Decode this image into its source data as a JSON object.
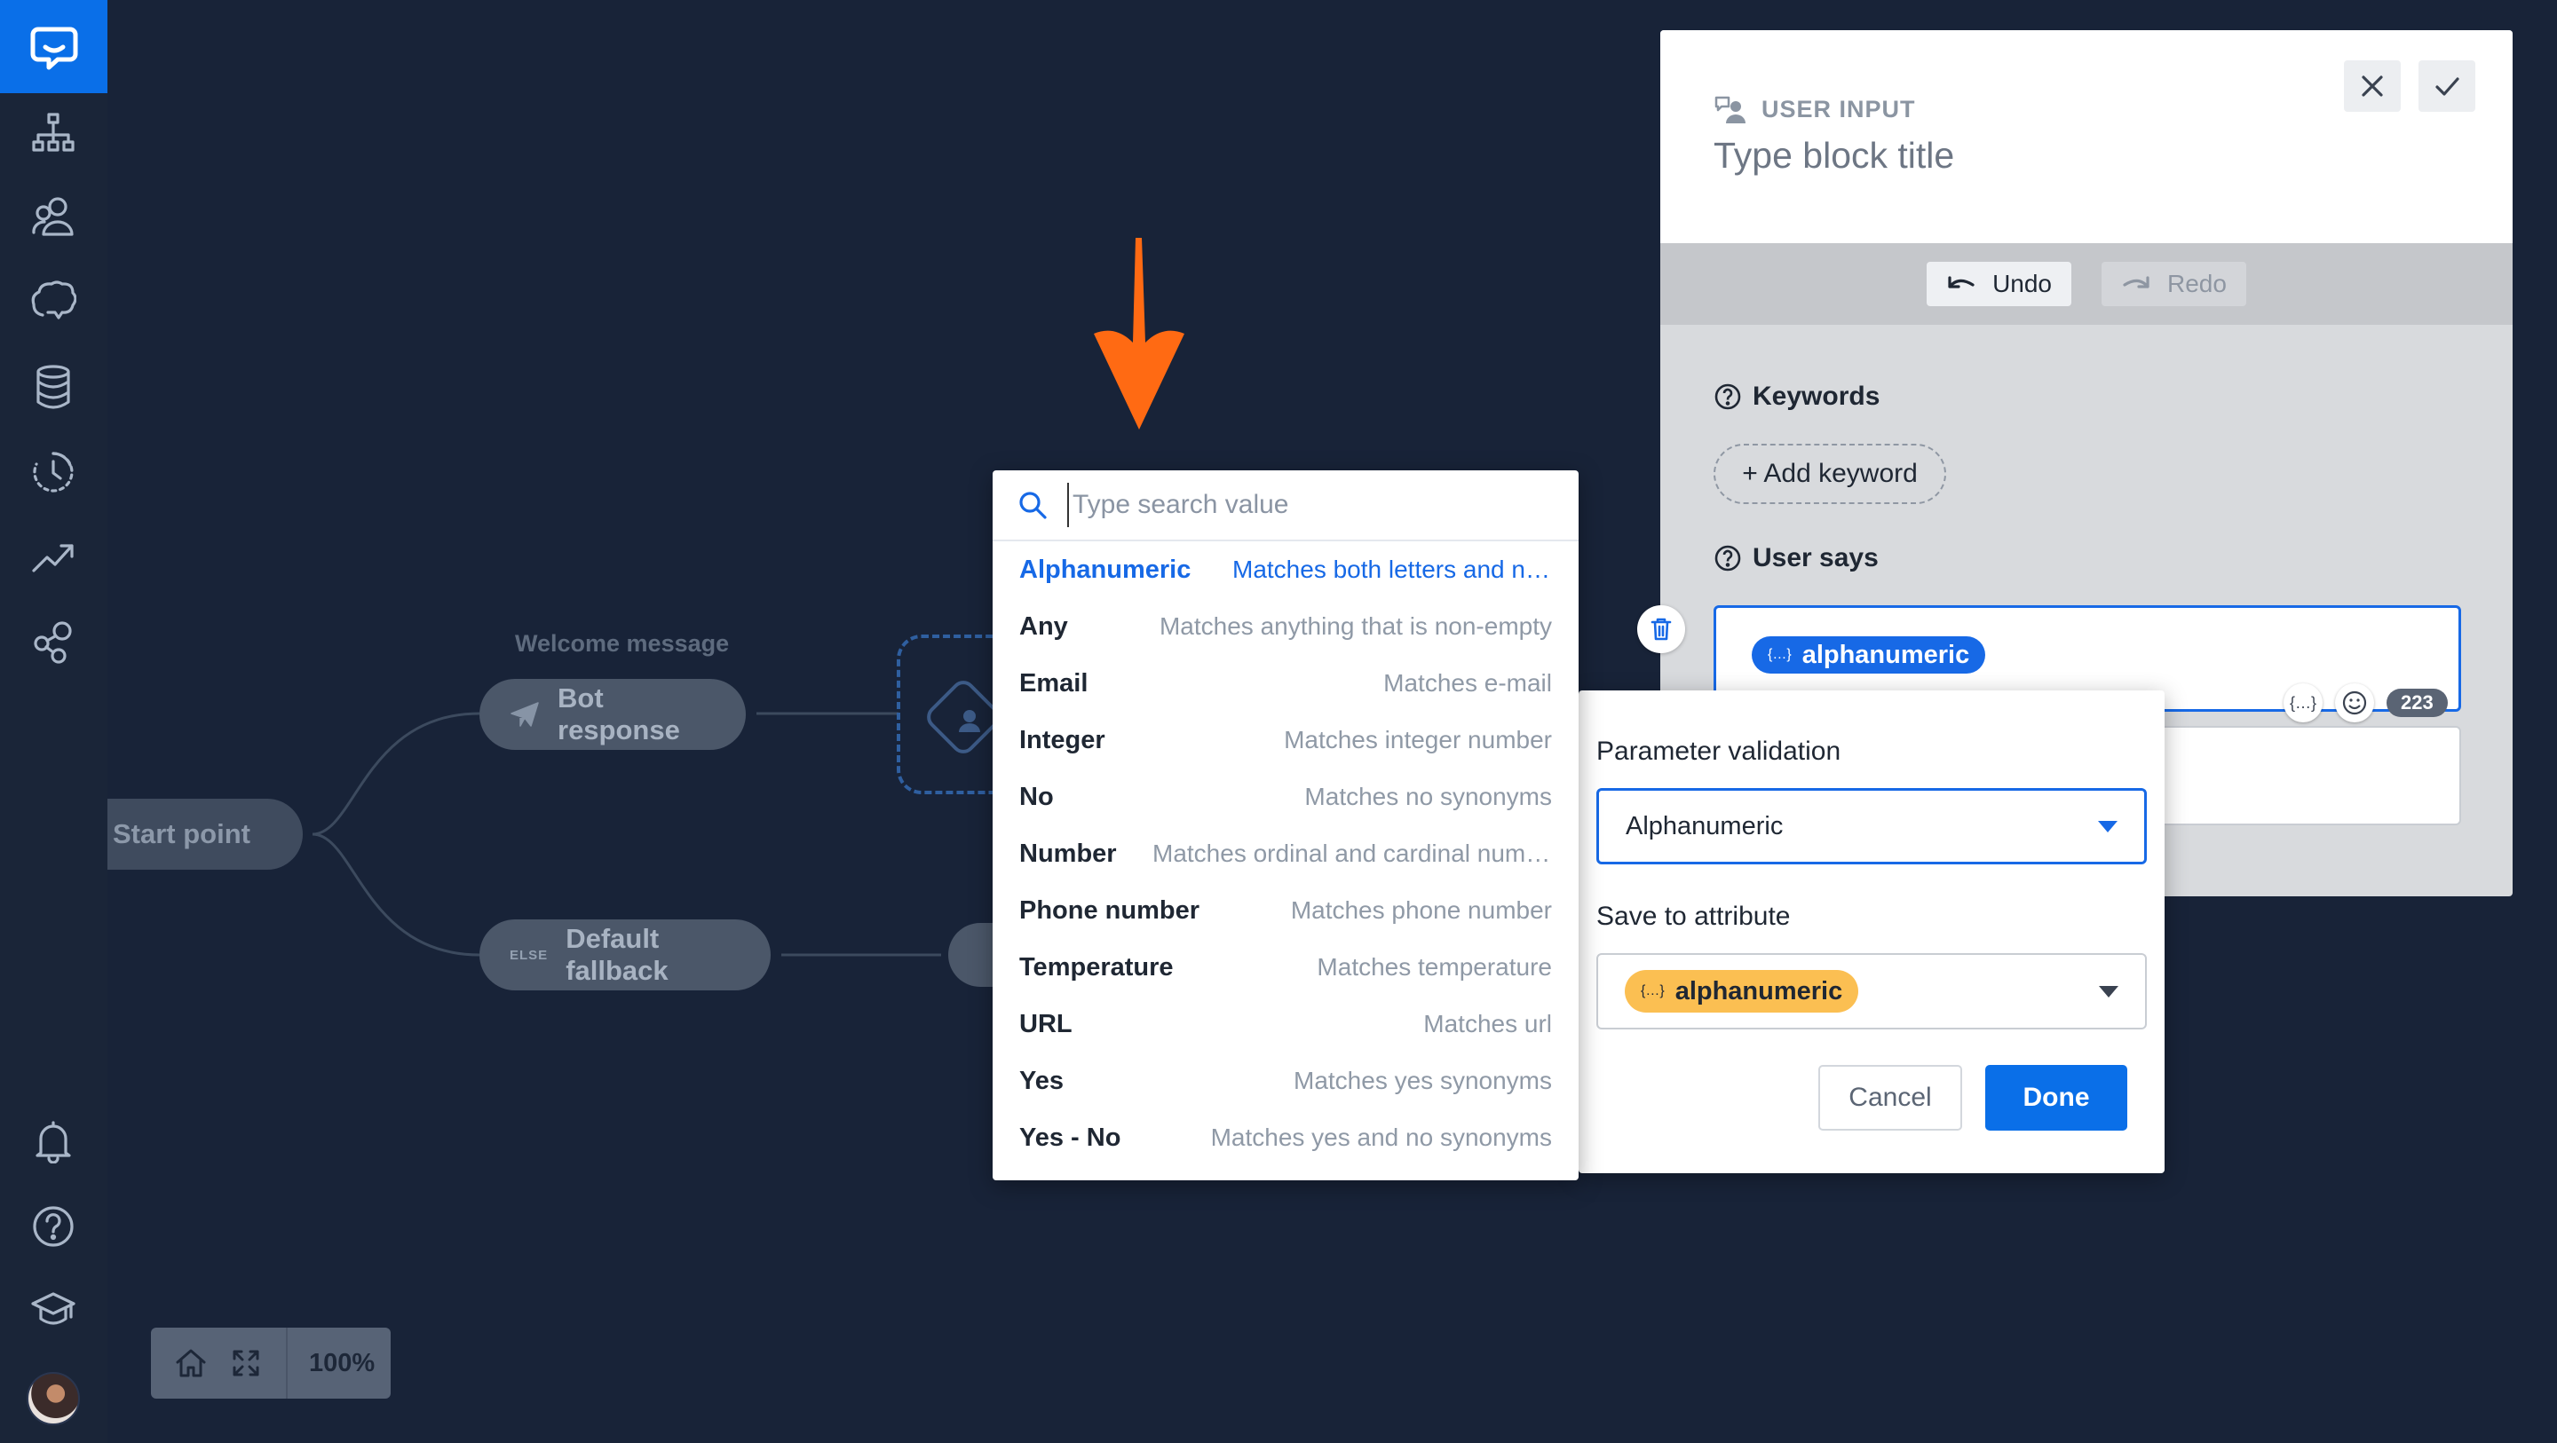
{
  "sidebar": {
    "logo_icon": "chat-bubble-logo-icon",
    "items": [
      {
        "name": "stories",
        "icon": "sitemap-icon"
      },
      {
        "name": "users",
        "icon": "users-icon"
      },
      {
        "name": "training",
        "icon": "brain-icon"
      },
      {
        "name": "data",
        "icon": "database-icon"
      },
      {
        "name": "history",
        "icon": "history-clock-icon"
      },
      {
        "name": "reports",
        "icon": "trend-chart-icon"
      },
      {
        "name": "integrations",
        "icon": "nodes-icon"
      },
      {
        "name": "notifications",
        "icon": "bell-icon"
      },
      {
        "name": "help",
        "icon": "question-icon"
      },
      {
        "name": "academy",
        "icon": "graduation-cap-icon"
      }
    ]
  },
  "flow": {
    "start_label": "Start point",
    "welcome_label": "Welcome message",
    "bot_response_label": "Bot response",
    "else_tag": "ELSE",
    "fallback_label": "Default fallback"
  },
  "zoom": {
    "level": "100%"
  },
  "search": {
    "placeholder": "Type search value",
    "options": [
      {
        "name": "Alphanumeric",
        "desc": "Matches both letters and numbers",
        "active": true
      },
      {
        "name": "Any",
        "desc": "Matches anything that is non-empty"
      },
      {
        "name": "Email",
        "desc": "Matches e-mail"
      },
      {
        "name": "Integer",
        "desc": "Matches integer number"
      },
      {
        "name": "No",
        "desc": "Matches no synonyms"
      },
      {
        "name": "Number",
        "desc": "Matches ordinal and cardinal numbers"
      },
      {
        "name": "Phone number",
        "desc": "Matches phone number"
      },
      {
        "name": "Temperature",
        "desc": "Matches temperature"
      },
      {
        "name": "URL",
        "desc": "Matches url"
      },
      {
        "name": "Yes",
        "desc": "Matches yes synonyms"
      },
      {
        "name": "Yes - No",
        "desc": "Matches yes and no synonyms"
      }
    ]
  },
  "panel": {
    "type_label": "USER INPUT",
    "title_placeholder": "Type block title",
    "undo_label": "Undo",
    "redo_label": "Redo",
    "keywords_label": "Keywords",
    "add_keyword_label": "+ Add keyword",
    "user_says_label": "User says",
    "chip_label": "alphanumeric",
    "char_count": "223"
  },
  "popover": {
    "validation_label": "Parameter validation",
    "validation_value": "Alphanumeric",
    "attribute_label": "Save to attribute",
    "attribute_value": "alphanumeric",
    "cancel_label": "Cancel",
    "done_label": "Done"
  },
  "colors": {
    "background": "#182338",
    "accent": "#0a6fe8",
    "arrow": "#ff6a13",
    "attribute_chip": "#fbbf52"
  }
}
